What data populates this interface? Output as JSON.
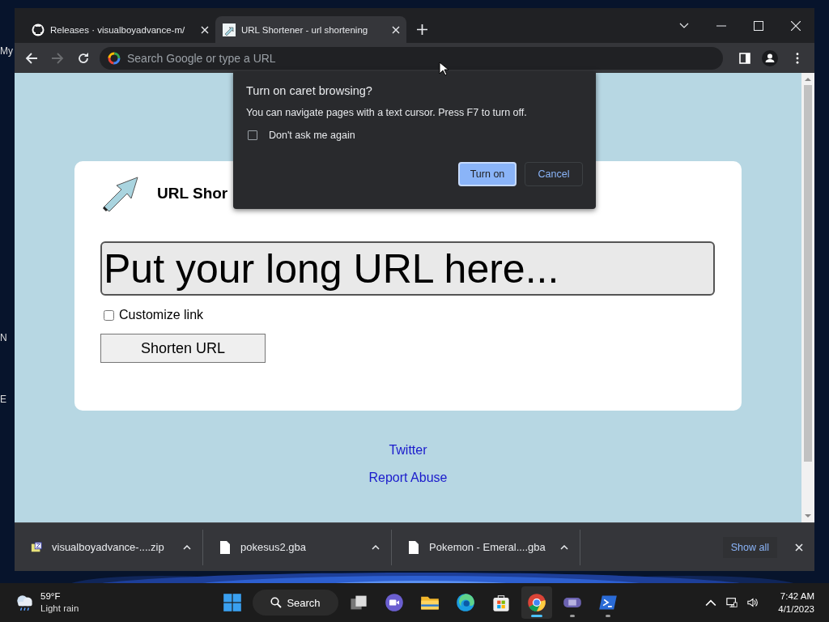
{
  "desktop": {
    "icon_labels": [
      "My",
      "N",
      "E"
    ]
  },
  "browser": {
    "tabs": [
      {
        "title": "Releases · visualboyadvance-m/",
        "kind": "github",
        "selected": false
      },
      {
        "title": "URL Shortener - url shortening",
        "kind": "page",
        "selected": true
      }
    ],
    "toolbar": {
      "back_disabled": false,
      "forward_disabled": true,
      "address_placeholder": "Search Google or type a URL"
    },
    "page": {
      "title": "URL Shor",
      "url_placeholder": "Put your long URL here...",
      "customize": {
        "label": "Customize link",
        "checked": false
      },
      "submit": "Shorten URL",
      "links": [
        "Twitter",
        "Report Abuse"
      ]
    },
    "dialog": {
      "title": "Turn on caret browsing?",
      "message": "You can navigate pages with a text cursor. Press F7 to turn off.",
      "checkbox": {
        "label": "Don't ask me again",
        "checked": false
      },
      "buttons": [
        {
          "label": "Turn on",
          "selected": true
        },
        {
          "label": "Cancel",
          "selected": false
        }
      ]
    },
    "downloads": {
      "items": [
        {
          "name": "visualboyadvance-....zip",
          "kind": "zip"
        },
        {
          "name": "pokesus2.gba",
          "kind": "file"
        },
        {
          "name": "Pokemon - Emeral....gba",
          "kind": "file"
        }
      ],
      "show_all": "Show all"
    }
  },
  "taskbar": {
    "weather": {
      "temp": "59°F",
      "condition": "Light rain"
    },
    "search": "Search",
    "apps": [
      {
        "kind": "start",
        "running": false,
        "selected": false
      },
      {
        "kind": "taskview",
        "running": false,
        "selected": false
      },
      {
        "kind": "chat",
        "running": false,
        "selected": false
      },
      {
        "kind": "folder",
        "running": false,
        "selected": false
      },
      {
        "kind": "edge",
        "running": false,
        "selected": false
      },
      {
        "kind": "store",
        "running": false,
        "selected": false
      },
      {
        "kind": "chrome",
        "running": true,
        "selected": true
      },
      {
        "kind": "gameboy",
        "running": true,
        "selected": false
      },
      {
        "kind": "terminal",
        "running": true,
        "selected": false
      }
    ],
    "time": "7:42 AM",
    "date": "4/1/2023"
  }
}
